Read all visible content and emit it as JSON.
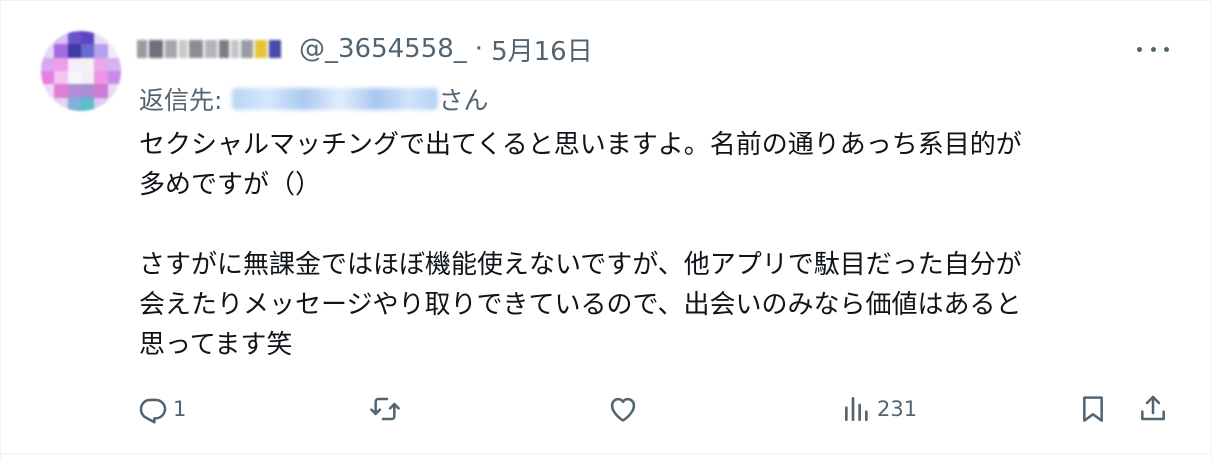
{
  "tweet": {
    "handle": "@_3654558_",
    "separator": "·",
    "date": "5月16日",
    "replying_prefix": "返信先:",
    "replying_suffix": "さん",
    "text": "セクシャルマッチングで出てくると思いますよ。名前の通りあっち系目的が\n多めですが（）\n\nさすがに無課金ではほぼ機能使えないですが、他アプリで駄目だった自分が\n会えたりメッセージやり取りできているので、出会いのみなら価値はあると\n思ってます笑"
  },
  "actions": {
    "reply_count": "1",
    "retweet_count": "",
    "like_count": "",
    "views_count": "231"
  },
  "icons": {
    "reply": "reply-icon",
    "retweet": "retweet-icon",
    "like": "heart-icon",
    "views": "views-icon",
    "bookmark": "bookmark-icon",
    "share": "share-icon",
    "more": "more-icon"
  },
  "colors": {
    "text": "#0f1419",
    "secondary": "#536471",
    "divider": "#eff3f4"
  }
}
